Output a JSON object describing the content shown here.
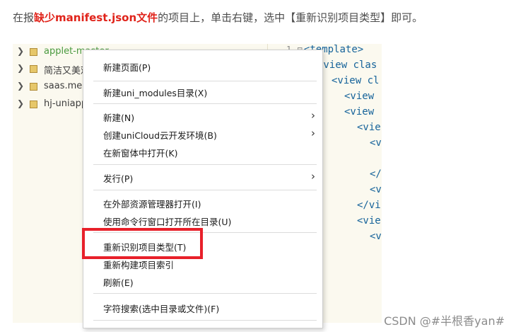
{
  "intro": {
    "before": "在报",
    "highlight": "缺少manifest.json文件",
    "after": "的项目上，单击右键，选中【重新识别项目类型】即可。"
  },
  "tree": {
    "items": [
      {
        "label": "applet-master"
      },
      {
        "label": "简洁又美观"
      },
      {
        "label": "saas.mem"
      },
      {
        "label": "hj-uniapp"
      }
    ]
  },
  "code": {
    "lines": [
      {
        "num": "1",
        "fold": "⊟",
        "text": "<template>"
      },
      {
        "num": "",
        "fold": "",
        "text": "<view clas"
      },
      {
        "num": "",
        "fold": "",
        "text": "<view cl"
      },
      {
        "num": "",
        "fold": "",
        "text": "<view"
      },
      {
        "num": "",
        "fold": "",
        "text": "<view"
      },
      {
        "num": "",
        "fold": "",
        "text": "<vie"
      },
      {
        "num": "",
        "fold": "",
        "text": "<v"
      },
      {
        "num": "",
        "fold": "",
        "text": "</"
      },
      {
        "num": "",
        "fold": "",
        "text": "<v"
      },
      {
        "num": "",
        "fold": "",
        "text": "</vi"
      },
      {
        "num": "",
        "fold": "",
        "text": "<vie"
      },
      {
        "num": "",
        "fold": "",
        "text": "<v"
      }
    ]
  },
  "menu": {
    "items": [
      {
        "label": "新建页面(P)",
        "submenu": false
      },
      {
        "label": "新建uni_modules目录(X)",
        "submenu": false
      },
      {
        "label": "新建(N)",
        "submenu": true
      },
      {
        "label": "创建uniCloud云开发环境(B)",
        "submenu": true
      },
      {
        "label": "在新窗体中打开(K)",
        "submenu": false
      },
      {
        "label": "发行(P)",
        "submenu": true
      },
      {
        "label": "在外部资源管理器打开(I)",
        "submenu": false
      },
      {
        "label": "使用命令行窗口打开所在目录(U)",
        "submenu": false
      },
      {
        "label": "重新识别项目类型(T)",
        "submenu": false
      },
      {
        "label": "重新构建项目索引",
        "submenu": false
      },
      {
        "label": "刷新(E)",
        "submenu": false
      },
      {
        "label": "字符搜索(选中目录或文件)(F)",
        "submenu": false
      }
    ],
    "submenu_arrow": "›",
    "highlighted": "重新识别项目类型(T)"
  },
  "watermark": "CSDN @#半根香yan#",
  "colors": {
    "highlight_text": "#e0231a",
    "annotation_box": "#e8202a",
    "tree_first_item": "#4a9a3f",
    "code_tag": "#16639a",
    "panel_bg": "#fbf9ef"
  }
}
